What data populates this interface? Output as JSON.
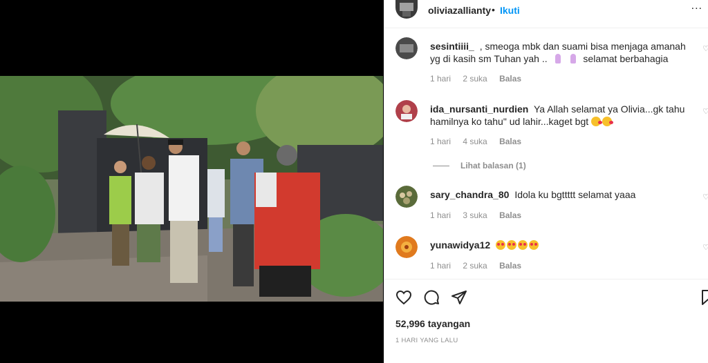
{
  "post": {
    "username": "oliviazallianty",
    "separator": "•",
    "follow_label": "Ikuti",
    "more_label": "..."
  },
  "comments": [
    {
      "user": "sesintiiii_",
      "text_a": ", smeoga mbk dan suami bisa menjaga amanah yg di kasih sm Tuhan yah ..",
      "text_b": "selamat berbahagia",
      "time": "1 hari",
      "likes": "2 suka",
      "reply": "Balas",
      "avatar_color": "#4a4a4a"
    },
    {
      "user": "ida_nursanti_nurdien",
      "text_a": "Ya Allah selamat ya Olivia...gk tahu hamilnya ko tahu\" ud lahir...kaget bgt",
      "time": "1 hari",
      "likes": "4 suka",
      "reply": "Balas",
      "avatar_color": "#b0404a"
    },
    {
      "user": "sary_chandra_80",
      "text_a": "Idola ku bgttttt selamat yaaa",
      "time": "1 hari",
      "likes": "3 suka",
      "reply": "Balas",
      "avatar_color": "#5a6b3a"
    },
    {
      "user": "yunawidya12",
      "text_a": "",
      "time": "1 hari",
      "likes": "2 suka",
      "reply": "Balas",
      "avatar_color": "#e07a1e"
    }
  ],
  "view_replies": "Lihat balasan (1)",
  "actions": {
    "icons": [
      "heart-icon",
      "comment-icon",
      "share-icon",
      "bookmark-icon"
    ]
  },
  "views": "52,996 tayangan",
  "posted_time": "1 HARI YANG LALU",
  "colors": {
    "accent": "#0095f6",
    "muted": "#8e8e8e",
    "text": "#262626"
  }
}
